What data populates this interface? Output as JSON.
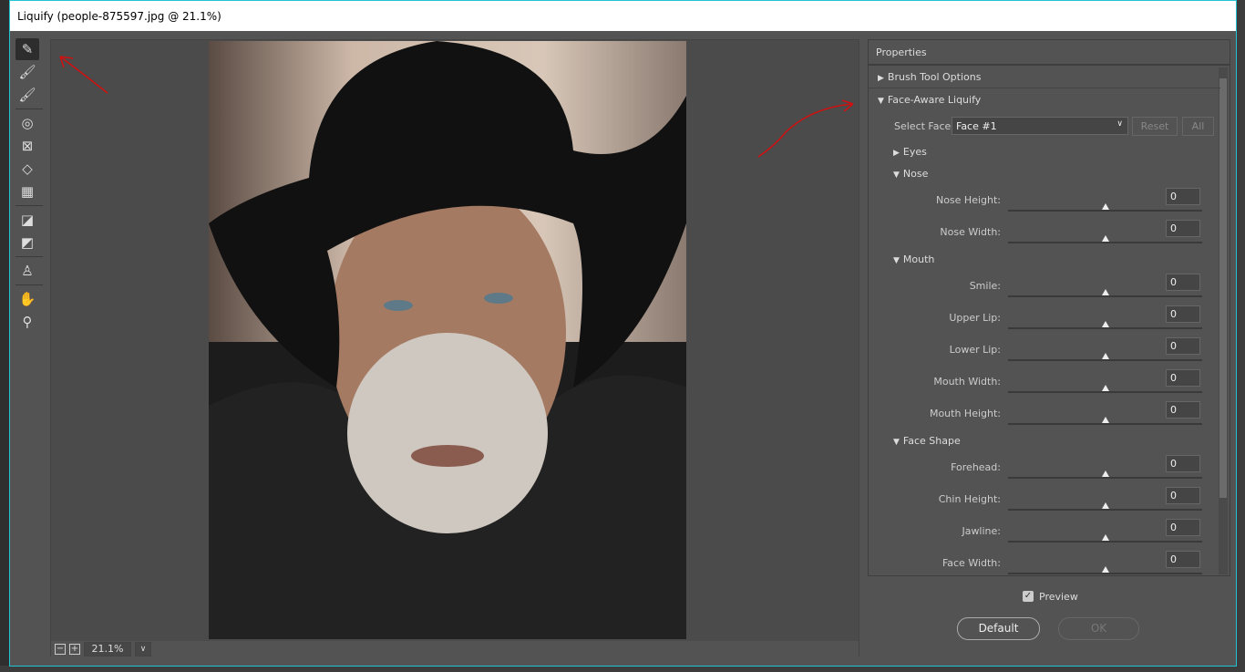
{
  "window": {
    "title": "Liquify (people-875597.jpg @ 21.1%)"
  },
  "toolbar": {
    "tools": [
      {
        "name": "forward-warp",
        "glyph": "✎",
        "active": true
      },
      {
        "name": "reconstruct",
        "glyph": "🖌"
      },
      {
        "name": "smooth",
        "glyph": "🖌"
      },
      {
        "name": "twirl",
        "glyph": "◎"
      },
      {
        "name": "pucker",
        "glyph": "⊠"
      },
      {
        "name": "bloat",
        "glyph": "◇"
      },
      {
        "name": "push-left",
        "glyph": "▦"
      },
      {
        "name": "freeze-mask",
        "glyph": "◪"
      },
      {
        "name": "thaw-mask",
        "glyph": "◩"
      },
      {
        "name": "face",
        "glyph": "♙"
      },
      {
        "name": "hand",
        "glyph": "✋"
      },
      {
        "name": "zoom",
        "glyph": "⚲"
      }
    ]
  },
  "zoombar": {
    "minus": "−",
    "plus": "+",
    "zoom": "21.1%"
  },
  "properties": {
    "title": "Properties",
    "brush_tool_options": "Brush Tool Options",
    "face_aware": "Face-Aware Liquify",
    "select_face_label": "Select Face:",
    "select_face_value": "Face #1",
    "reset": "Reset",
    "all": "All",
    "eyes": "Eyes",
    "nose": "Nose",
    "mouth": "Mouth",
    "face_shape": "Face Shape",
    "sliders": {
      "nose_height": {
        "label": "Nose Height:",
        "value": "0"
      },
      "nose_width": {
        "label": "Nose Width:",
        "value": "0"
      },
      "smile": {
        "label": "Smile:",
        "value": "0"
      },
      "upper_lip": {
        "label": "Upper Lip:",
        "value": "0"
      },
      "lower_lip": {
        "label": "Lower Lip:",
        "value": "0"
      },
      "mouth_width": {
        "label": "Mouth Width:",
        "value": "0"
      },
      "mouth_height": {
        "label": "Mouth Height:",
        "value": "0"
      },
      "forehead": {
        "label": "Forehead:",
        "value": "0"
      },
      "chin_height": {
        "label": "Chin Height:",
        "value": "0"
      },
      "jawline": {
        "label": "Jawline:",
        "value": "0"
      },
      "face_width": {
        "label": "Face Width:",
        "value": "0"
      }
    },
    "slider_range": [
      -100,
      100
    ]
  },
  "footer": {
    "preview": "Preview",
    "preview_checked": true,
    "default": "Default",
    "ok": "OK"
  },
  "colors": {
    "annotation": "#d01010",
    "accent_border": "#22c3d3"
  }
}
